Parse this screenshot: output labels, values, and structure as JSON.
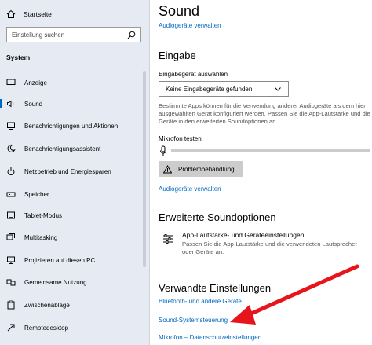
{
  "sidebar": {
    "home_label": "Startseite",
    "search_placeholder": "Einstellung suchen",
    "section_title": "System",
    "items": [
      {
        "label": "Anzeige",
        "icon": "monitor-icon"
      },
      {
        "label": "Sound",
        "icon": "speaker-icon",
        "active": true
      },
      {
        "label": "Benachrichtigungen und Aktionen",
        "icon": "notification-icon"
      },
      {
        "label": "Benachrichtigungsassistent",
        "icon": "moon-icon"
      },
      {
        "label": "Netzbetrieb und Energiesparen",
        "icon": "power-icon"
      },
      {
        "label": "Speicher",
        "icon": "storage-icon"
      },
      {
        "label": "Tablet-Modus",
        "icon": "tablet-icon"
      },
      {
        "label": "Multitasking",
        "icon": "multitasking-icon"
      },
      {
        "label": "Projizieren auf diesen PC",
        "icon": "project-icon"
      },
      {
        "label": "Gemeinsame Nutzung",
        "icon": "shared-icon"
      },
      {
        "label": "Zwischenablage",
        "icon": "clipboard-icon"
      },
      {
        "label": "Remotedesktop",
        "icon": "remote-icon"
      }
    ]
  },
  "main": {
    "title": "Sound",
    "manage_devices_link": "Audiogeräte verwalten",
    "input_section": {
      "heading": "Eingabe",
      "device_label": "Eingabegerät auswählen",
      "device_value": "Keine Eingabegeräte gefunden",
      "description": "Bestimmte Apps können für die Verwendung anderer Audiogeräte als dem hier ausgewählten Gerät konfiguriert werden. Passen Sie die App-Lautstärke und die Geräte in den erweiterten Soundoptionen an.",
      "mic_test_label": "Mikrofon testen",
      "mic_level": 0,
      "troubleshoot_label": "Problembehandlung",
      "manage_devices_link": "Audiogeräte verwalten"
    },
    "advanced_section": {
      "heading": "Erweiterte Soundoptionen",
      "option_title": "App-Lautstärke- und Geräteeinstellungen",
      "option_description": "Passen Sie die App-Lautstärke und die verwendeten Lautsprecher oder Geräte an."
    },
    "related_section": {
      "heading": "Verwandte Einstellungen",
      "links": [
        "Bluetooth- und andere Geräte",
        "Sound-Systemsteuerung",
        "Mikrofon – Datenschutzeinstellungen"
      ]
    }
  },
  "colors": {
    "sidebar_bg": "#e6ebf3",
    "accent": "#0067c0",
    "annotation_arrow": "#e8141c"
  }
}
